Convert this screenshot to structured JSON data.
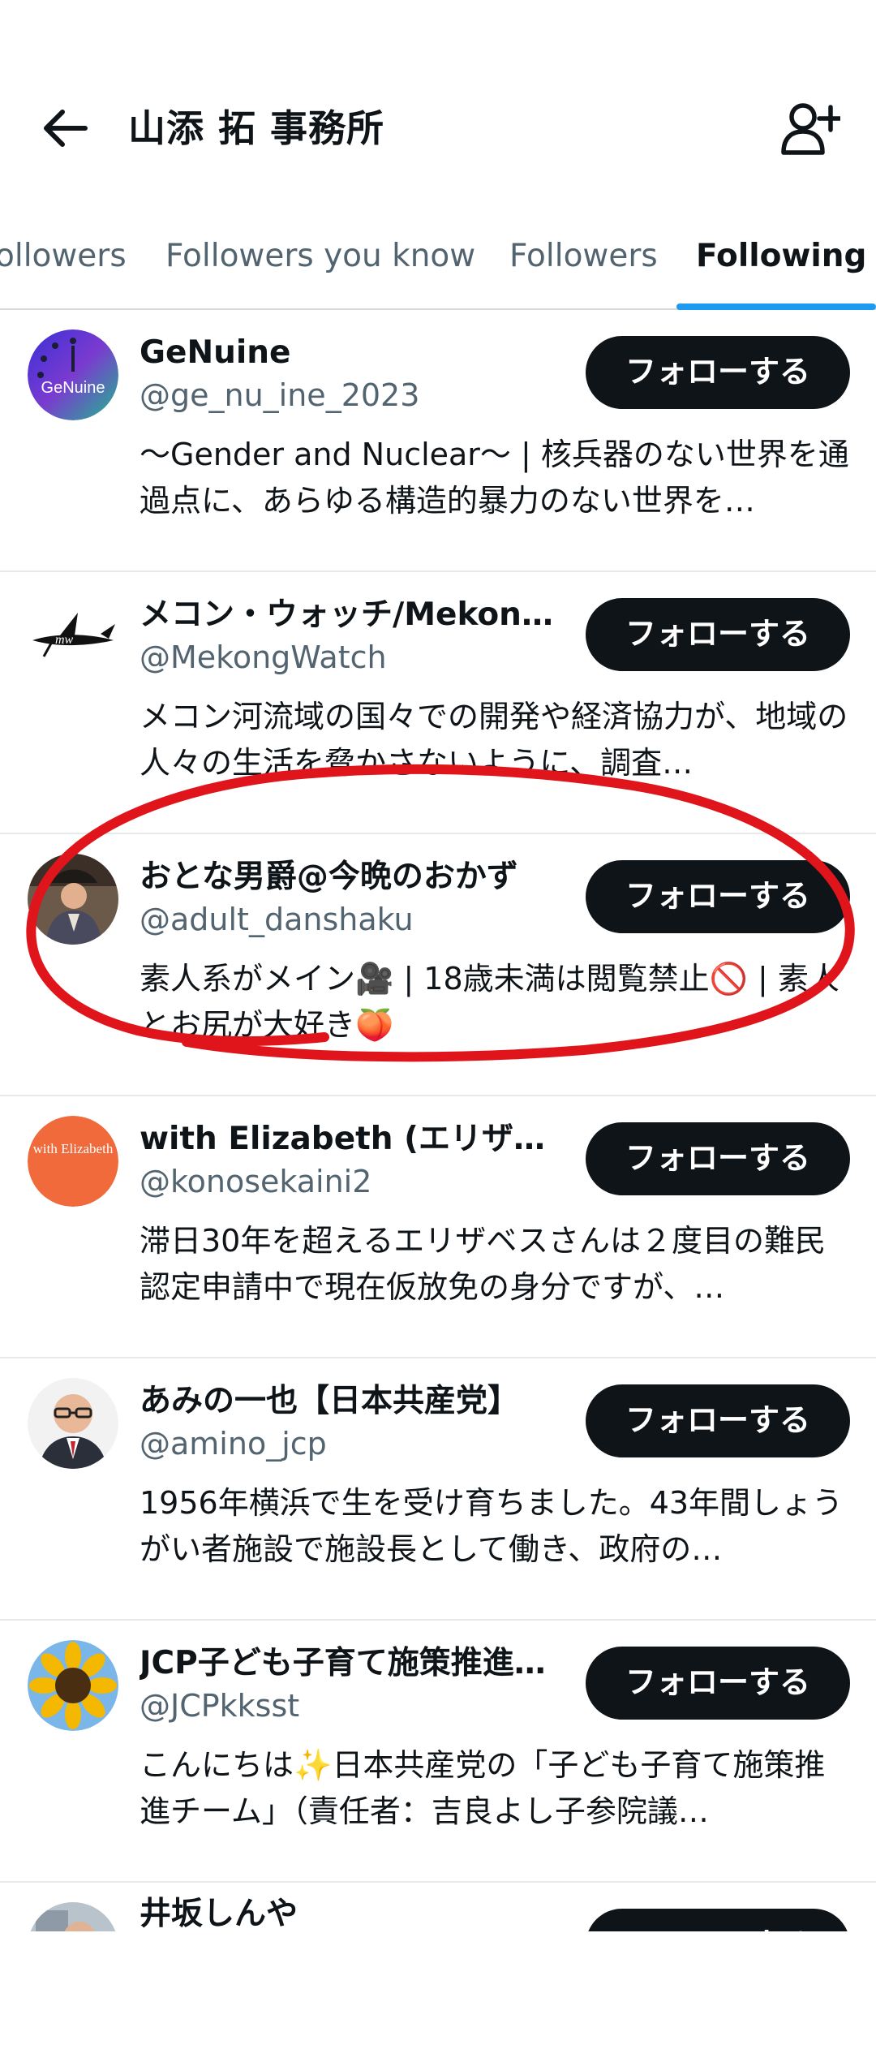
{
  "header": {
    "title": "山添 拓 事務所",
    "back_icon": "arrow-left-icon",
    "add_icon": "add-user-icon"
  },
  "tabs": [
    {
      "label": "ollowers",
      "active": false
    },
    {
      "label": "Followers you know",
      "active": false
    },
    {
      "label": "Followers",
      "active": false
    },
    {
      "label": "Following",
      "active": true
    }
  ],
  "colors": {
    "accent": "#1d9bf0",
    "button_bg": "#0f1419",
    "secondary_text": "#536471",
    "annotation": "#e0151b"
  },
  "follow_label": "フォローする",
  "users": [
    {
      "name": "GeNuine",
      "handle": "@ge_nu_ine_2023",
      "bio": "〜Gender and Nuclear〜 | 核兵器のない世界を通過点に、あらゆる構造的暴力のない世界を…",
      "avatar_text": "GeNuine"
    },
    {
      "name": "メコン・ウォッチ/Mekon…",
      "handle": "@MekongWatch",
      "bio": "メコン河流域の国々での開発や経済協力が、地域の人々の生活を脅かさないように、調査…",
      "avatar_text": "mw"
    },
    {
      "name": "おとな男爵@今晩のおかず",
      "handle": "@adult_danshaku",
      "bio": "素人系がメイン🎥 | 18歳未満は閲覧禁止🚫 | 素人とお尻が大好き🍑",
      "avatar_text": ""
    },
    {
      "name": "with Elizabeth (エリザベ…",
      "handle": "@konosekaini2",
      "bio": "滞日30年を超えるエリザベスさんは２度目の難民認定申請中で現在仮放免の身分ですが、…",
      "avatar_text": "with Elizabeth"
    },
    {
      "name": "あみの一也【日本共産党】",
      "handle": "@amino_jcp",
      "bio": "1956年横浜で生を受け育ちました。43年間しょうがい者施設で施設長として働き、政府の…",
      "avatar_text": ""
    },
    {
      "name": "JCP子ども子育て施策推進…",
      "handle": "@JCPkksst",
      "bio": "こんにちは✨日本共産党の「子ども子育て施策推進チーム」（責任者：吉良よし子参院議…",
      "avatar_text": ""
    },
    {
      "name": "井坂しんや",
      "handle": "",
      "bio": "",
      "avatar_text": ""
    }
  ]
}
